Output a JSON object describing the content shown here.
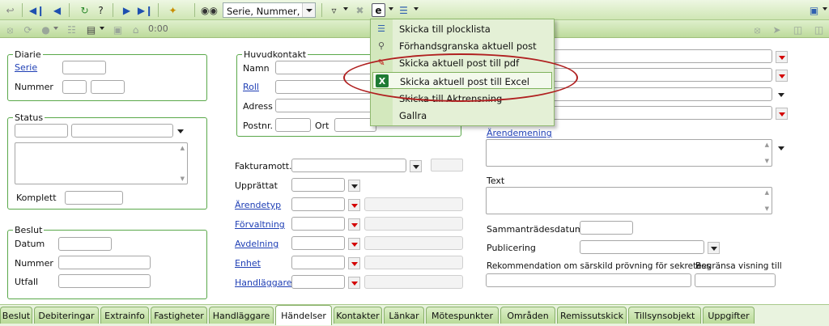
{
  "toolbar": {
    "search_combo_value": "Serie, Nummer, Di",
    "time_value": "0:00"
  },
  "menu": {
    "items": [
      {
        "label": "Skicka till plocklista",
        "icon": "list-send-icon"
      },
      {
        "label": "Förhandsgranska aktuell post",
        "icon": "preview-magnifier-icon"
      },
      {
        "label": "Skicka aktuell post till pdf",
        "icon": "pdf-file-icon"
      },
      {
        "label": "Skicka aktuell post till Excel",
        "icon": "excel-file-icon"
      },
      {
        "label": "Skicka till Aktrensning",
        "icon": ""
      },
      {
        "label": "Gallra",
        "icon": ""
      }
    ],
    "highlight_color": "#b02020"
  },
  "diarie": {
    "legend": "Diarie",
    "serie_label": "Serie",
    "nummer_label": "Nummer"
  },
  "status": {
    "legend": "Status",
    "komplett_label": "Komplett"
  },
  "beslut": {
    "legend": "Beslut",
    "datum_label": "Datum",
    "nummer_label": "Nummer",
    "utfall_label": "Utfall"
  },
  "huvudkontakt": {
    "legend": "Huvudkontakt",
    "namn_label": "Namn",
    "roll_label": "Roll",
    "adress_label": "Adress",
    "postnr_label": "Postnr.",
    "ort_label": "Ort"
  },
  "middle": {
    "fakturamott_label": "Fakturamott.",
    "upprattat_label": "Upprättat",
    "arendetyp_label": "Ärendetyp",
    "forvaltning_label": "Förvaltning",
    "avdelning_label": "Avdelning",
    "enhet_label": "Enhet",
    "handlaggare_label": "Handläggare"
  },
  "right": {
    "arendemening_label": "Ärendemening",
    "text_label": "Text",
    "sammantradesdatum_label": "Sammanträdesdatum",
    "publicering_label": "Publicering",
    "rekommendation_label": "Rekommendation om särskild prövning för sekretess",
    "begransa_label": "Begränsa visning till"
  },
  "tabs": [
    {
      "label": "Beslut"
    },
    {
      "label": "Debiteringar"
    },
    {
      "label": "Extrainfo"
    },
    {
      "label": "Fastigheter"
    },
    {
      "label": "Handläggare"
    },
    {
      "label": "Händelser"
    },
    {
      "label": "Kontakter"
    },
    {
      "label": "Länkar"
    },
    {
      "label": "Mötespunkter"
    },
    {
      "label": "Områden"
    },
    {
      "label": "Remissutskick"
    },
    {
      "label": "Tillsynsobjekt"
    },
    {
      "label": "Uppgifter"
    }
  ],
  "active_tab": "Händelser"
}
